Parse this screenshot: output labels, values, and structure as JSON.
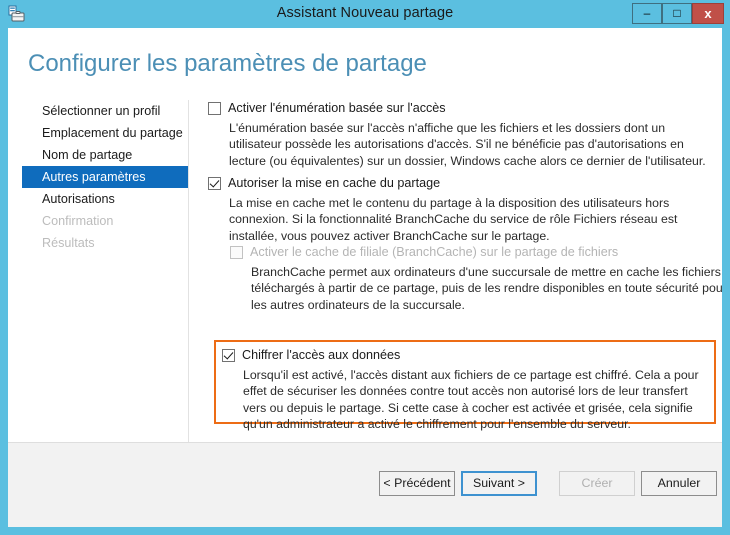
{
  "window": {
    "title": "Assistant Nouveau partage",
    "icon": "share-server-icon",
    "accent_color": "#5bbfe0",
    "controls": {
      "minimize": "–",
      "maximize": "□",
      "close": "x"
    }
  },
  "page": {
    "heading": "Configurer les paramètres de partage",
    "heading_color": "#4c8fb5"
  },
  "sidebar": {
    "selected_color": "#0f6cbd",
    "items": [
      {
        "label": "Sélectionner un profil",
        "state": "normal"
      },
      {
        "label": "Emplacement du partage",
        "state": "normal"
      },
      {
        "label": "Nom de partage",
        "state": "normal"
      },
      {
        "label": "Autres paramètres",
        "state": "selected"
      },
      {
        "label": "Autorisations",
        "state": "normal"
      },
      {
        "label": "Confirmation",
        "state": "disabled"
      },
      {
        "label": "Résultats",
        "state": "disabled"
      }
    ]
  },
  "options": {
    "access_based_enumeration": {
      "label": "Activer l'énumération basée sur l'accès",
      "checked": false,
      "enabled": true,
      "description": "L'énumération basée sur l'accès n'affiche que les fichiers et les dossiers dont un utilisateur possède les autorisations d'accès. S'il ne bénéficie pas d'autorisations en lecture (ou équivalentes) sur un dossier, Windows cache alors ce dernier de l'utilisateur."
    },
    "allow_caching": {
      "label": "Autoriser la mise en cache du partage",
      "checked": true,
      "enabled": true,
      "description": "La mise en cache met le contenu du partage à la disposition des utilisateurs hors connexion. Si la fonctionnalité BranchCache du service de rôle Fichiers réseau est installée, vous pouvez activer BranchCache sur le partage."
    },
    "branch_cache": {
      "label": "Activer le cache de filiale (BranchCache) sur le partage de fichiers",
      "checked": false,
      "enabled": false,
      "description": "BranchCache permet aux ordinateurs d'une succursale de mettre en cache les fichiers téléchargés à partir de ce partage, puis de les rendre disponibles en toute sécurité pour les autres ordinateurs de la succursale."
    },
    "encrypt_data_access": {
      "label": "Chiffrer l'accès aux données",
      "checked": true,
      "enabled": true,
      "highlighted": true,
      "highlight_color": "#ed6c15",
      "description": "Lorsqu'il est activé, l'accès distant aux fichiers de ce partage est chiffré. Cela a pour effet de sécuriser les données contre tout accès non autorisé lors de leur transfert vers ou depuis le partage. Si cette case à cocher est activée et grisée, cela signifie qu'un administrateur a activé le chiffrement pour l'ensemble du serveur."
    }
  },
  "footer": {
    "buttons": [
      {
        "label": "< Précédent",
        "enabled": true,
        "focused": false
      },
      {
        "label": "Suivant >",
        "enabled": true,
        "focused": true
      },
      {
        "label": "Créer",
        "enabled": false,
        "focused": false
      },
      {
        "label": "Annuler",
        "enabled": true,
        "focused": false
      }
    ]
  }
}
